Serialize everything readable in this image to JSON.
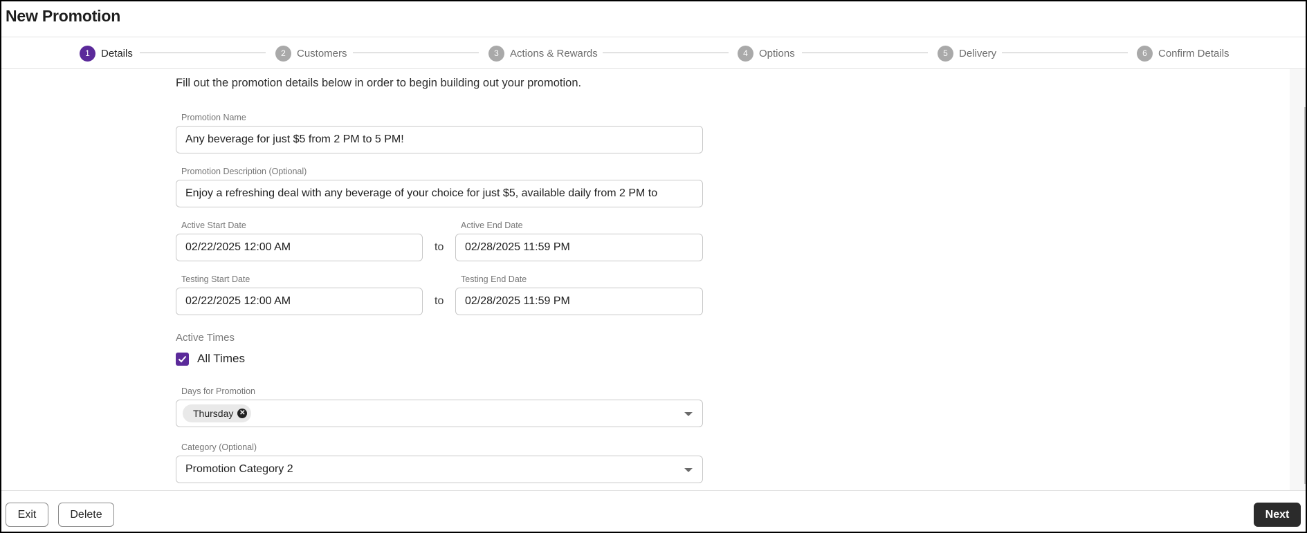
{
  "header": {
    "title": "New Promotion"
  },
  "stepper": {
    "steps": [
      {
        "number": "1",
        "label": "Details",
        "active": true
      },
      {
        "number": "2",
        "label": "Customers",
        "active": false
      },
      {
        "number": "3",
        "label": "Actions & Rewards",
        "active": false
      },
      {
        "number": "4",
        "label": "Options",
        "active": false
      },
      {
        "number": "5",
        "label": "Delivery",
        "active": false
      },
      {
        "number": "6",
        "label": "Confirm Details",
        "active": false
      }
    ]
  },
  "form": {
    "intro": "Fill out the promotion details below in order to begin building out your promotion.",
    "promotion_name": {
      "label": "Promotion Name",
      "value": "Any beverage for just $5 from 2 PM to 5 PM!"
    },
    "promotion_description": {
      "label": "Promotion Description (Optional)",
      "value": "Enjoy a refreshing deal with any beverage of your choice for just $5, available daily from 2 PM to"
    },
    "active_start": {
      "label": "Active Start Date",
      "value": "02/22/2025 12:00 AM"
    },
    "active_end": {
      "label": "Active End Date",
      "value": "02/28/2025 11:59 PM"
    },
    "testing_start": {
      "label": "Testing Start Date",
      "value": "02/22/2025 12:00 AM"
    },
    "testing_end": {
      "label": "Testing End Date",
      "value": "02/28/2025 11:59 PM"
    },
    "to_text": "to",
    "active_times": {
      "label": "Active Times",
      "checkbox_label": "All Times",
      "checked": true
    },
    "days": {
      "label": "Days for Promotion",
      "chips": [
        "Thursday"
      ]
    },
    "category": {
      "label": "Category (Optional)",
      "value": "Promotion Category 2"
    }
  },
  "footer": {
    "exit_label": "Exit",
    "delete_label": "Delete",
    "next_label": "Next"
  },
  "colors": {
    "accent": "#5b2a9a",
    "inactive_step": "#a9a9a9",
    "primary_button": "#2b2b2b"
  }
}
